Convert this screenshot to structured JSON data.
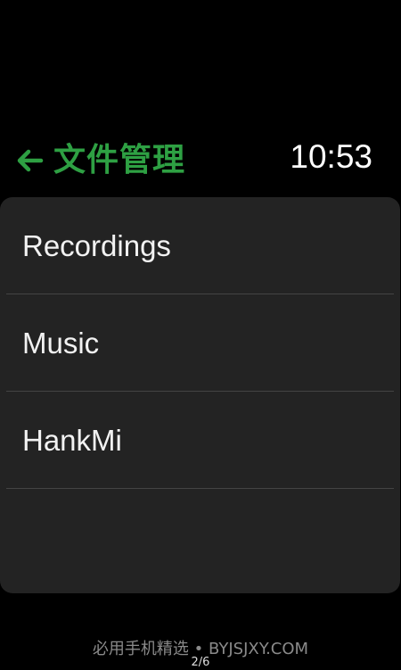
{
  "header": {
    "back_icon": "arrow-left-icon",
    "title": "文件管理",
    "time": "10:53"
  },
  "colors": {
    "accent": "#2ea043",
    "card_background": "#232323",
    "background": "#000000",
    "divider": "#444444"
  },
  "folders": [
    {
      "label": "Recordings"
    },
    {
      "label": "Music"
    },
    {
      "label": "HankMi"
    }
  ],
  "footer": {
    "watermark": "必用手机精选 • BYJSJXY.COM",
    "page_indicator": "2/6"
  }
}
